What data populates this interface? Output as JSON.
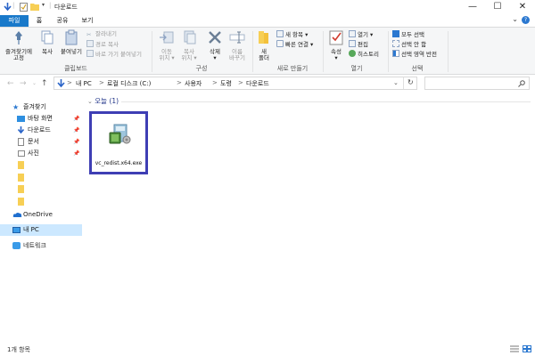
{
  "window": {
    "title": "다운로드",
    "minimize": "—",
    "maximize": "☐",
    "close": "✕"
  },
  "ribbon_tabs": {
    "file": "파일",
    "home": "홈",
    "share": "공유",
    "view": "보기"
  },
  "ribbon": {
    "clipboard": {
      "group_label": "클립보드",
      "pin_label_1": "즐겨찾기에",
      "pin_label_2": "고정",
      "copy": "복사",
      "paste": "붙여넣기",
      "cut": "잘라내기",
      "copy_path": "경로 복사",
      "paste_shortcut": "바로 가기 붙여넣기"
    },
    "organize": {
      "group_label": "구성",
      "move_1": "이동",
      "move_2": "위치 ▾",
      "copy_1": "복사",
      "copy_2": "위치 ▾",
      "delete_1": "삭제",
      "delete_2": "▾",
      "rename_1": "이름",
      "rename_2": "바꾸기"
    },
    "new": {
      "group_label": "새로 만들기",
      "new_folder_1": "새",
      "new_folder_2": "폴더",
      "new_item": "새 항목 ▾",
      "easy_access": "빠른 연결 ▾"
    },
    "open": {
      "group_label": "열기",
      "properties_1": "속성",
      "properties_2": "▾",
      "open": "열기 ▾",
      "edit": "편집",
      "history": "히스토리"
    },
    "select": {
      "group_label": "선택",
      "select_all": "모두 선택",
      "select_none": "선택 안 함",
      "invert": "선택 영역 반전"
    }
  },
  "address": {
    "breadcrumb": [
      "내 PC",
      "로컬 디스크 (C:)",
      "사용자",
      "도령",
      "다운로드"
    ],
    "separator": ">",
    "search_placeholder": ""
  },
  "navpane": {
    "quick_access": "즐겨찾기",
    "items": [
      {
        "label": "바탕 화면",
        "pinned": true
      },
      {
        "label": "다운로드",
        "pinned": true
      },
      {
        "label": "문서",
        "pinned": true
      },
      {
        "label": "사진",
        "pinned": true
      }
    ],
    "folders": [
      "",
      "",
      "",
      ""
    ],
    "onedrive": "OneDrive",
    "this_pc": "내 PC",
    "network": "네트워크"
  },
  "content": {
    "group_header": "오늘 (1)",
    "files": [
      {
        "name": "vc_redist.x64.exe"
      }
    ]
  },
  "status": {
    "item_count": "1개 항목"
  },
  "colors": {
    "accent": "#1979ca",
    "selection_border": "#3e3eb4",
    "nav_selected": "#cce8ff",
    "folder_yellow": "#f7cf55"
  },
  "icons": [
    "save-icon",
    "checkbox-icon",
    "dropdown-icon",
    "pin-icon",
    "copy-icon",
    "paste-icon",
    "scissors-icon",
    "folder-icon",
    "delete-icon",
    "properties-icon",
    "installer-icon",
    "search-icon",
    "refresh-icon",
    "onedrive-icon",
    "pc-icon",
    "network-icon",
    "details-view-icon",
    "tiles-view-icon"
  ]
}
